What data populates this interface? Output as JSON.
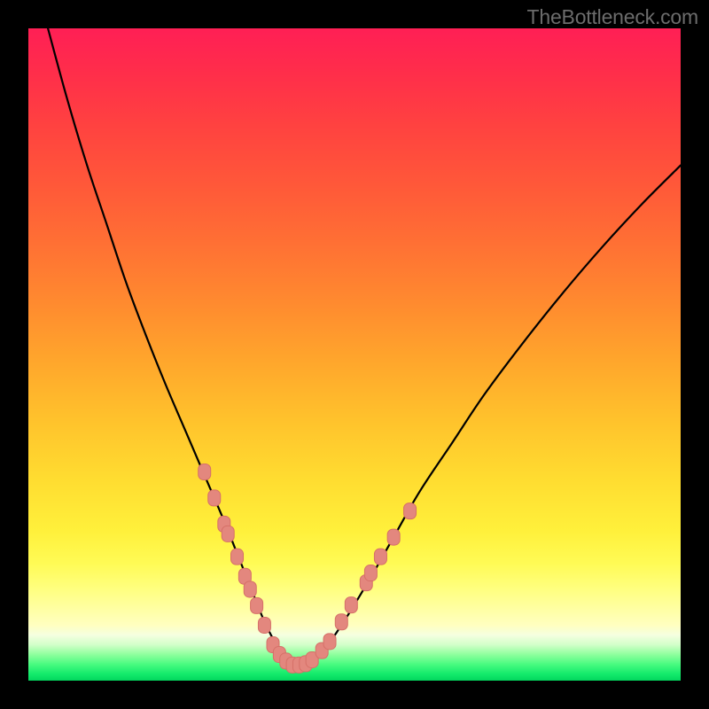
{
  "attribution": "TheBottleneck.com",
  "colors": {
    "frame_bg": "#000000",
    "curve_stroke": "#000000",
    "marker_fill": "#e3877e",
    "marker_stroke": "#d67068"
  },
  "chart_data": {
    "type": "line",
    "title": "",
    "xlabel": "",
    "ylabel": "",
    "xlim": [
      0,
      100
    ],
    "ylim": [
      0,
      100
    ],
    "grid": false,
    "series": [
      {
        "name": "bottleneck-curve",
        "x": [
          3,
          6,
          9,
          12,
          15,
          18,
          21,
          24,
          27,
          30,
          32,
          34,
          36,
          38,
          40,
          42,
          45,
          48,
          52,
          56,
          60,
          65,
          70,
          76,
          82,
          88,
          94,
          100
        ],
        "values": [
          100,
          89,
          79,
          70,
          61,
          53,
          45.5,
          38.5,
          31.5,
          24.5,
          19.5,
          14.5,
          9.5,
          5.5,
          2.5,
          2.5,
          4.5,
          8.5,
          15,
          22,
          29,
          36.5,
          44,
          52,
          59.5,
          66.5,
          73,
          79
        ]
      }
    ],
    "markers": {
      "name": "highlight-points",
      "points": [
        {
          "x": 27.0,
          "y": 32.0
        },
        {
          "x": 28.5,
          "y": 28.0
        },
        {
          "x": 30.0,
          "y": 24.0
        },
        {
          "x": 30.6,
          "y": 22.5
        },
        {
          "x": 32.0,
          "y": 19.0
        },
        {
          "x": 33.2,
          "y": 16.0
        },
        {
          "x": 34.0,
          "y": 14.0
        },
        {
          "x": 35.0,
          "y": 11.5
        },
        {
          "x": 36.2,
          "y": 8.5
        },
        {
          "x": 37.5,
          "y": 5.5
        },
        {
          "x": 38.5,
          "y": 4.0
        },
        {
          "x": 39.5,
          "y": 3.0
        },
        {
          "x": 40.5,
          "y": 2.4
        },
        {
          "x": 41.5,
          "y": 2.4
        },
        {
          "x": 42.5,
          "y": 2.6
        },
        {
          "x": 43.5,
          "y": 3.2
        },
        {
          "x": 45.0,
          "y": 4.6
        },
        {
          "x": 46.2,
          "y": 6.0
        },
        {
          "x": 48.0,
          "y": 9.0
        },
        {
          "x": 49.5,
          "y": 11.6
        },
        {
          "x": 51.8,
          "y": 15.0
        },
        {
          "x": 52.5,
          "y": 16.5
        },
        {
          "x": 54.0,
          "y": 19.0
        },
        {
          "x": 56.0,
          "y": 22.0
        },
        {
          "x": 58.5,
          "y": 26.0
        }
      ]
    }
  }
}
